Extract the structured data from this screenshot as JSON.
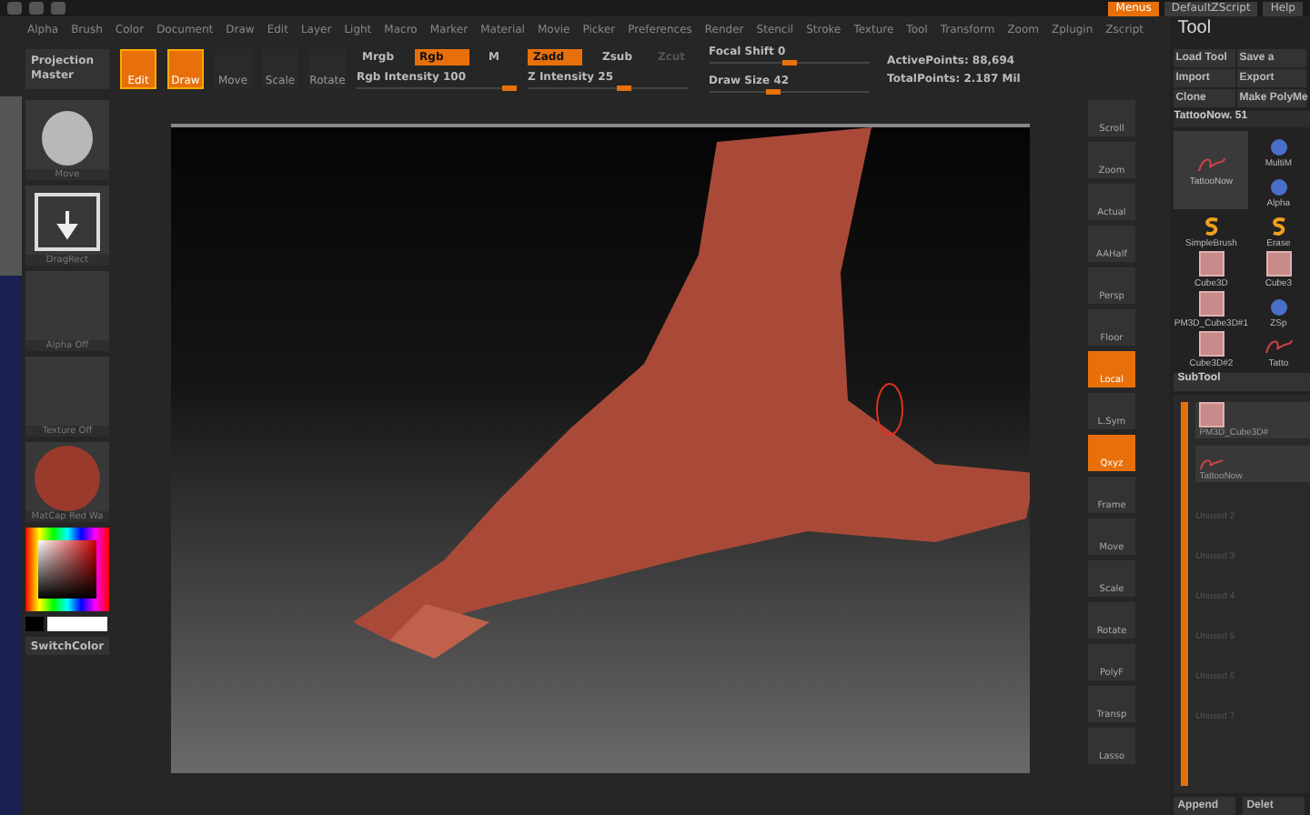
{
  "title_bar": {
    "buttons": [
      {
        "label": "Menus",
        "selected": true
      },
      {
        "label": "DefaultZScript",
        "selected": false
      },
      {
        "label": "Help",
        "selected": false
      }
    ]
  },
  "menu_bar": [
    "Alpha",
    "Brush",
    "Color",
    "Document",
    "Draw",
    "Edit",
    "Layer",
    "Light",
    "Macro",
    "Marker",
    "Material",
    "Movie",
    "Picker",
    "Preferences",
    "Render",
    "Stencil",
    "Stroke",
    "Texture",
    "Tool",
    "Transform",
    "Zoom",
    "Zplugin",
    "Zscript"
  ],
  "top_shelf": {
    "projection_master": "Projection Master",
    "modes": [
      {
        "label": "Edit",
        "selected": true
      },
      {
        "label": "Draw",
        "selected": true
      },
      {
        "label": "Move",
        "selected": false
      },
      {
        "label": "Scale",
        "selected": false
      },
      {
        "label": "Rotate",
        "selected": false
      }
    ],
    "color_modes": [
      {
        "label": "Mrgb",
        "selected": false
      },
      {
        "label": "Rgb",
        "selected": true
      },
      {
        "label": "M",
        "selected": false
      }
    ],
    "z_modes": [
      {
        "label": "Zadd",
        "selected": true
      },
      {
        "label": "Zsub",
        "selected": false
      },
      {
        "label": "Zcut",
        "selected": false,
        "disabled": true
      }
    ],
    "sliders": [
      {
        "label": "Rgb Intensity",
        "reading": "100",
        "level": 0.95
      },
      {
        "label": "Z Intensity",
        "reading": "25",
        "level": 0.6
      },
      {
        "label": "Focal Shift",
        "reading": "0",
        "level": 0.5
      },
      {
        "label": "Draw Size",
        "reading": "42",
        "level": 0.4
      }
    ],
    "stats": [
      "ActivePoints: 88,694",
      "TotalPoints: 2.187 Mil"
    ]
  },
  "left_shelf": [
    {
      "label": "Move",
      "kind": "brush"
    },
    {
      "label": "DragRect",
      "kind": "stroke"
    },
    {
      "label": "Alpha Off",
      "kind": "empty"
    },
    {
      "label": "Texture Off",
      "kind": "empty"
    },
    {
      "label": "MatCap Red Wa",
      "kind": "material"
    }
  ],
  "switch_color": "SwitchColor",
  "right_shelf": [
    {
      "label": "Scroll",
      "selected": false
    },
    {
      "label": "Zoom",
      "selected": false
    },
    {
      "label": "Actual",
      "selected": false
    },
    {
      "label": "AAHalf",
      "selected": false
    },
    {
      "label": "Persp",
      "selected": false
    },
    {
      "label": "Floor",
      "selected": false
    },
    {
      "label": "Local",
      "selected": true
    },
    {
      "label": "L.Sym",
      "selected": false
    },
    {
      "label": "Qxyz",
      "selected": true
    },
    {
      "label": "Frame",
      "selected": false
    },
    {
      "label": "Move",
      "selected": false
    },
    {
      "label": "Scale",
      "selected": false
    },
    {
      "label": "Rotate",
      "selected": false
    },
    {
      "label": "PolyF",
      "selected": false
    },
    {
      "label": "Transp",
      "selected": false
    },
    {
      "label": "Lasso",
      "selected": false
    }
  ],
  "tool_panel": {
    "title": "Tool",
    "buttons": [
      "Load Tool",
      "Save a",
      "Import",
      "Export",
      "Clone",
      "Make PolyMe"
    ],
    "current_tool": "TattooNow. 51",
    "tools": [
      {
        "label": "MultiM",
        "kind": "ball"
      },
      {
        "label": "TattooNow",
        "kind": "stroke"
      },
      {
        "label": "Alpha",
        "kind": "ball"
      },
      {
        "label": "SimpleBrush",
        "kind": "brush"
      },
      {
        "label": "Erase",
        "kind": "brush"
      },
      {
        "label": "Cube3D",
        "kind": "cube"
      },
      {
        "label": "Cube3",
        "kind": "cube"
      },
      {
        "label": "PM3D_Cube3D#1",
        "kind": "cube"
      },
      {
        "label": "ZSp",
        "kind": "ball"
      },
      {
        "label": "Cube3D#2",
        "kind": "cube"
      },
      {
        "label": "Tatto",
        "kind": "stroke"
      }
    ],
    "subtool": {
      "title": "SubTool",
      "items": [
        {
          "label": "PM3D_Cube3D#",
          "kind": "cube"
        },
        {
          "label": "TattooNow",
          "kind": "stroke"
        },
        {
          "label": "Unused 2",
          "kind": "empty"
        },
        {
          "label": "Unused 3",
          "kind": "empty"
        },
        {
          "label": "Unused 4",
          "kind": "empty"
        },
        {
          "label": "Unused 5",
          "kind": "empty"
        },
        {
          "label": "Unused 6",
          "kind": "empty"
        },
        {
          "label": "Unused 7",
          "kind": "empty"
        }
      ],
      "buttons": [
        "Append",
        "Delet"
      ]
    }
  }
}
